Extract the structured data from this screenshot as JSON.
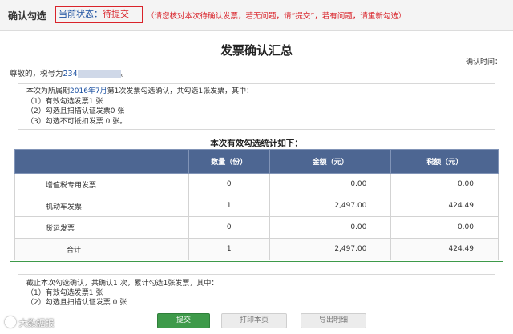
{
  "topbar": {
    "title": "确认勾选",
    "status_label": "当前状态：",
    "status_value": "待提交",
    "hint": "（请您核对本次待确认发票，若无问题，请“提交”，若有问题，请重新勾选）"
  },
  "heading": "发票确认汇总",
  "confirm_time_label": "确认时间：",
  "greeting": {
    "prefix": "尊敬的，税号为",
    "tax_no_visible": "234",
    "suffix": "。"
  },
  "summary": {
    "line1_a": "本次为所属期",
    "period": "2016年7月",
    "line1_b": "第1次发票勾选确认，共勾选1张发票，其中：",
    "items": [
      "（1）有效勾选发票1 张",
      "（2）勾选且扫描认证发票0 张",
      "（3）勾选不可抵扣发票 0 张。"
    ]
  },
  "stats_title": "本次有效勾选统计如下：",
  "table": {
    "headers": [
      "",
      "数量（份）",
      "金额（元）",
      "税额（元）"
    ],
    "rows": [
      {
        "name": "增值税专用发票",
        "count": "0",
        "amount": "0.00",
        "tax": "0.00"
      },
      {
        "name": "机动车发票",
        "count": "1",
        "amount": "2,497.00",
        "tax": "424.49"
      },
      {
        "name": "货运发票",
        "count": "0",
        "amount": "0.00",
        "tax": "0.00"
      },
      {
        "name": "合计",
        "count": "1",
        "amount": "2,497.00",
        "tax": "424.49"
      }
    ]
  },
  "cumulative": {
    "line1": "截止本次勾选确认，共确认1 次，累计勾选1张发票，其中：",
    "items": [
      "（1）有效勾选发票1 张",
      "（2）勾选且扫描认证发票 0 张"
    ]
  },
  "buttons": {
    "submit": "提交",
    "print": "打印本页",
    "export": "导出明细"
  },
  "watermark": "大数据报",
  "colors": {
    "accent_red": "#d9232a",
    "header_blue": "#4d6692",
    "link_blue": "#1a4fa0",
    "submit_green": "#3e9a4a"
  }
}
